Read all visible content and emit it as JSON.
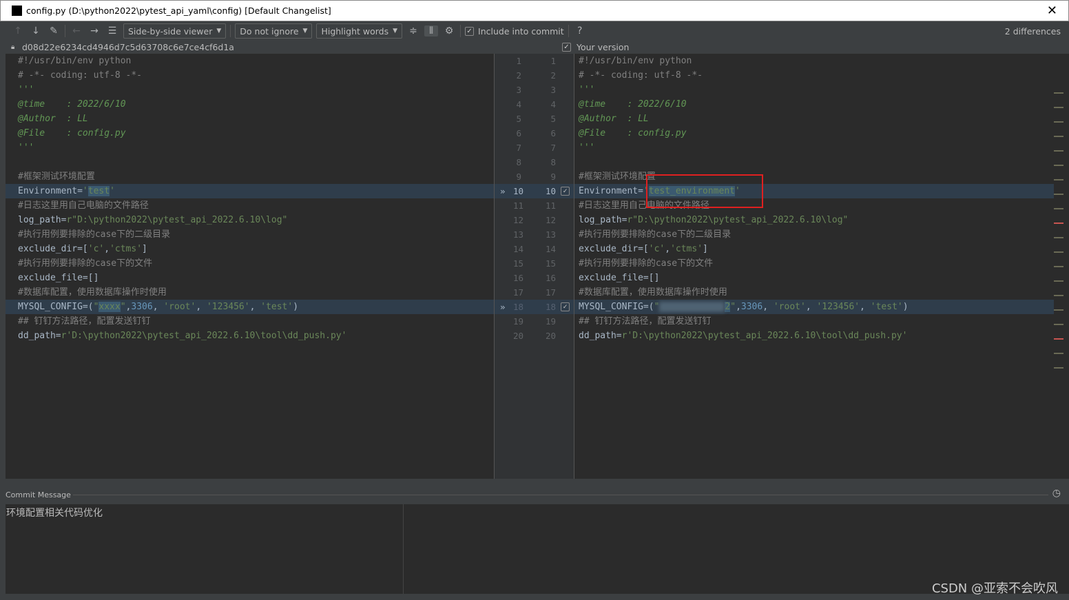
{
  "window": {
    "title": "config.py (D:\\python2022\\pytest_api_yaml\\config) [Default Changelist]",
    "logo": "PC"
  },
  "toolbar": {
    "viewer": "Side-by-side viewer",
    "ignore": "Do not ignore",
    "highlight": "Highlight words",
    "include": "Include into commit",
    "help": "?",
    "differences": "2 differences"
  },
  "info": {
    "revision": "d08d22e6234cd4946d7c5d63708c6e7ce4cf6d1a",
    "your_version": "Your version"
  },
  "left_lines": [
    [
      [
        "c-com",
        "#!/usr/bin/env python"
      ]
    ],
    [
      [
        "c-com",
        "# -*- coding: utf-8 -*-"
      ]
    ],
    [
      [
        "c-doc",
        "'''"
      ]
    ],
    [
      [
        "c-doc",
        "@time    : 2022/6/10"
      ]
    ],
    [
      [
        "c-doc",
        "@Author  : LL"
      ]
    ],
    [
      [
        "c-doc",
        "@File    : config.py"
      ]
    ],
    [
      [
        "c-doc",
        "'''"
      ]
    ],
    [],
    [
      [
        "c-com",
        "#框架测试环境配置"
      ]
    ],
    [
      [
        "c-def",
        "Environment="
      ],
      [
        "c-str",
        "'"
      ],
      [
        "c-str hl",
        "test"
      ],
      [
        "c-str",
        "'"
      ]
    ],
    [
      [
        "c-com",
        "#日志这里用自己电脑的文件路径"
      ]
    ],
    [
      [
        "c-def",
        "log_path="
      ],
      [
        "c-str",
        "r\"D:\\python2022\\pytest_api_2022.6.10\\log\""
      ]
    ],
    [
      [
        "c-com",
        "#执行用例要排除的case下的二级目录"
      ]
    ],
    [
      [
        "c-def",
        "exclude_dir=["
      ],
      [
        "c-str",
        "'c'"
      ],
      [
        "c-def",
        ","
      ],
      [
        "c-str",
        "'ctms'"
      ],
      [
        "c-def",
        "]"
      ]
    ],
    [
      [
        "c-com",
        "#执行用例要排除的case下的文件"
      ]
    ],
    [
      [
        "c-def",
        "exclude_file=[]"
      ]
    ],
    [
      [
        "c-com",
        "#数据库配置，使用数据库操作时使用"
      ]
    ],
    [
      [
        "c-def",
        "MYSQL_CONFIG=("
      ],
      [
        "c-str",
        "\""
      ],
      [
        "c-str hl",
        "xxxx"
      ],
      [
        "c-str",
        "\""
      ],
      [
        "c-def",
        ","
      ],
      [
        "c-num",
        "3306"
      ],
      [
        "c-def",
        ", "
      ],
      [
        "c-str",
        "'root'"
      ],
      [
        "c-def",
        ", "
      ],
      [
        "c-str",
        "'123456'"
      ],
      [
        "c-def",
        ", "
      ],
      [
        "c-str",
        "'test'"
      ],
      [
        "c-def",
        ")"
      ]
    ],
    [
      [
        "c-com",
        "## 钉钉方法路径，配置发送钉钉"
      ]
    ],
    [
      [
        "c-def",
        "dd_path="
      ],
      [
        "c-str",
        "r'D:\\python2022\\pytest_api_2022.6.10\\tool\\dd_push.py'"
      ]
    ]
  ],
  "right_lines": [
    [
      [
        "c-com",
        "#!/usr/bin/env python"
      ]
    ],
    [
      [
        "c-com",
        "# -*- coding: utf-8 -*-"
      ]
    ],
    [
      [
        "c-doc",
        "'''"
      ]
    ],
    [
      [
        "c-doc",
        "@time    : 2022/6/10"
      ]
    ],
    [
      [
        "c-doc",
        "@Author  : LL"
      ]
    ],
    [
      [
        "c-doc",
        "@File    : config.py"
      ]
    ],
    [
      [
        "c-doc",
        "'''"
      ]
    ],
    [],
    [
      [
        "c-com",
        "#框架测试环境配置"
      ]
    ],
    [
      [
        "c-def",
        "Environment="
      ],
      [
        "c-str",
        "'"
      ],
      [
        "c-str hl",
        "test_environment"
      ],
      [
        "c-str",
        "'"
      ]
    ],
    [
      [
        "c-com",
        "#日志这里用自己电脑的文件路径"
      ]
    ],
    [
      [
        "c-def",
        "log_path="
      ],
      [
        "c-str",
        "r\"D:\\python2022\\pytest_api_2022.6.10\\log\""
      ]
    ],
    [
      [
        "c-com",
        "#执行用例要排除的case下的二级目录"
      ]
    ],
    [
      [
        "c-def",
        "exclude_dir=["
      ],
      [
        "c-str",
        "'c'"
      ],
      [
        "c-def",
        ","
      ],
      [
        "c-str",
        "'ctms'"
      ],
      [
        "c-def",
        "]"
      ]
    ],
    [
      [
        "c-com",
        "#执行用例要排除的case下的文件"
      ]
    ],
    [
      [
        "c-def",
        "exclude_file=[]"
      ]
    ],
    [
      [
        "c-com",
        "#数据库配置，使用数据库操作时使用"
      ]
    ],
    [
      [
        "c-def",
        "MYSQL_CONFIG=("
      ],
      [
        "c-str",
        "\""
      ],
      [
        "blur",
        ""
      ],
      [
        "c-str hl",
        "2"
      ],
      [
        "c-str",
        "\""
      ],
      [
        "c-def",
        ","
      ],
      [
        "c-num",
        "3306"
      ],
      [
        "c-def",
        ", "
      ],
      [
        "c-str",
        "'root'"
      ],
      [
        "c-def",
        ", "
      ],
      [
        "c-str",
        "'123456'"
      ],
      [
        "c-def",
        ", "
      ],
      [
        "c-str",
        "'test'"
      ],
      [
        "c-def",
        ")"
      ]
    ],
    [
      [
        "c-com",
        "## 钉钉方法路径，配置发送钉钉"
      ]
    ],
    [
      [
        "c-def",
        "dd_path="
      ],
      [
        "c-str",
        "r'D:\\python2022\\pytest_api_2022.6.10\\tool\\dd_push.py'"
      ]
    ]
  ],
  "changed_lines": [
    10,
    18
  ],
  "commit": {
    "label": "Commit Message",
    "message": "环境配置相关代码优化"
  },
  "watermark": "CSDN @亚索不会吹风"
}
